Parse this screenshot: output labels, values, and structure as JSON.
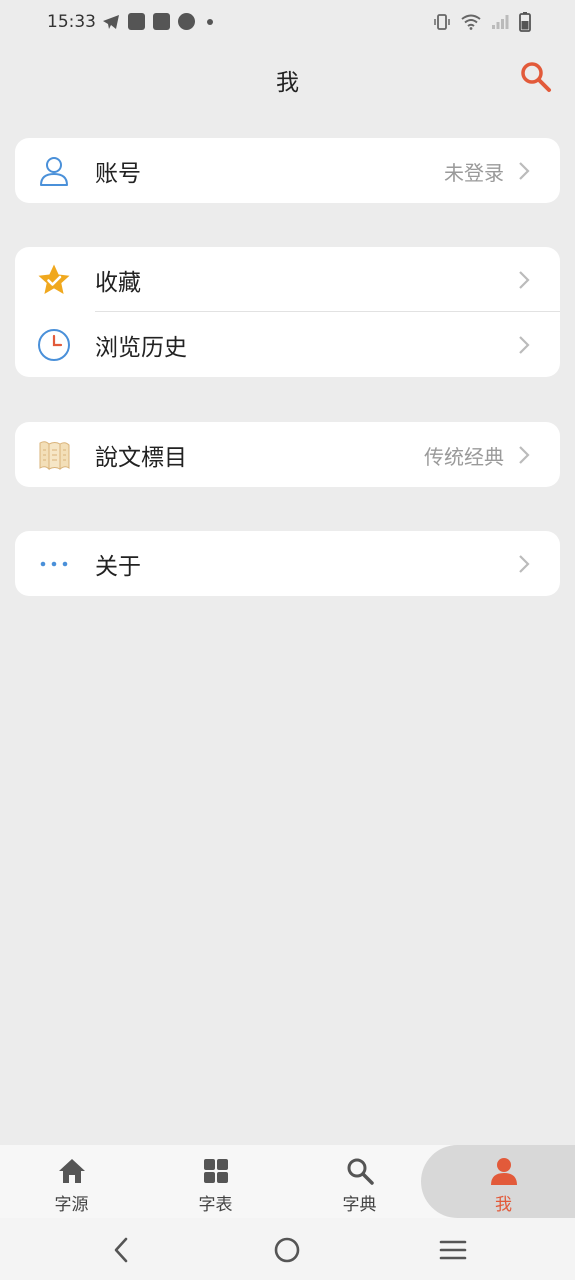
{
  "status_bar": {
    "time": "15:33",
    "left_icons": [
      "telegram-icon",
      "shopping-bag-icon",
      "shopping-bag-icon",
      "speedometer-icon",
      "dot-icon"
    ],
    "right_icons": [
      "vibrate-icon",
      "wifi-icon",
      "signal-icon",
      "battery-icon"
    ]
  },
  "header": {
    "title": "我",
    "search_icon": "search-icon",
    "accent_color": "#e25a3a"
  },
  "groups": [
    {
      "items": [
        {
          "label": "账号",
          "value": "未登录",
          "icon": "user-outline-icon"
        }
      ]
    },
    {
      "items": [
        {
          "label": "收藏",
          "value": "",
          "icon": "star-check-icon"
        },
        {
          "label": "浏览历史",
          "value": "",
          "icon": "clock-icon"
        }
      ]
    },
    {
      "items": [
        {
          "label": "說文標目",
          "value": "传统经典",
          "icon": "scroll-icon"
        }
      ]
    },
    {
      "items": [
        {
          "label": "关于",
          "value": "",
          "icon": "more-dots-icon"
        }
      ]
    }
  ],
  "tabbar": {
    "tabs": [
      {
        "label": "字源",
        "icon": "home-icon",
        "active": false
      },
      {
        "label": "字表",
        "icon": "grid-icon",
        "active": false
      },
      {
        "label": "字典",
        "icon": "search-icon",
        "active": false
      },
      {
        "label": "我",
        "icon": "person-icon",
        "active": true
      }
    ]
  },
  "navbar": {
    "buttons": [
      "back-icon",
      "home-circle-icon",
      "recents-icon"
    ]
  }
}
